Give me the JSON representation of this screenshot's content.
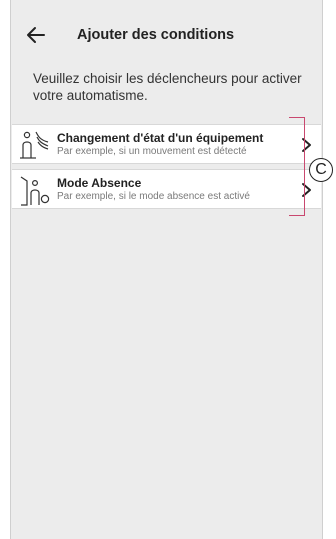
{
  "header": {
    "title": "Ajouter des conditions"
  },
  "intro": {
    "text": "Veuillez choisir les déclencheurs pour activer votre automatisme."
  },
  "options": [
    {
      "title": "Changement d'état d'un équipement",
      "subtitle": "Par exemple, si un mouvement est détecté",
      "icon": "motion-sensor-icon"
    },
    {
      "title": "Mode Absence",
      "subtitle": "Par exemple, si le mode absence est activé",
      "icon": "away-mode-icon"
    }
  ],
  "annotation": {
    "label": "C",
    "color": "#c9486f"
  }
}
